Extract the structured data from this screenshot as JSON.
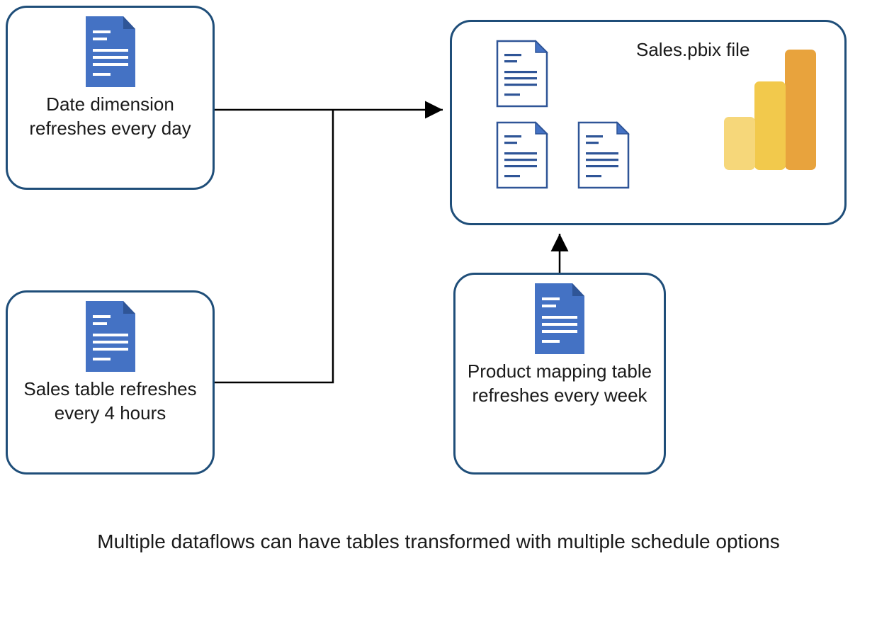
{
  "nodes": {
    "date_dim": {
      "label": "Date dimension refreshes every day",
      "icon": "document-solid-icon"
    },
    "sales_table": {
      "label": "Sales table refreshes every 4 hours",
      "icon": "document-solid-icon"
    },
    "product_mapping": {
      "label": "Product mapping table refreshes every week",
      "icon": "document-solid-icon"
    },
    "sales_pbix": {
      "title": "Sales.pbix file",
      "docs_icon": "document-outline-icon",
      "logo_icon": "powerbi-logo-icon"
    }
  },
  "caption": "Multiple dataflows can have tables transformed with multiple schedule options",
  "colors": {
    "border": "#1f4e79",
    "doc_fill": "#4472c4",
    "doc_line": "#ffffff",
    "outline_stroke": "#2f5597",
    "outline_fold": "#4472c4",
    "pbi_dark": "#e8a33d",
    "pbi_mid": "#f2c94c",
    "pbi_light": "#f6d77a"
  }
}
